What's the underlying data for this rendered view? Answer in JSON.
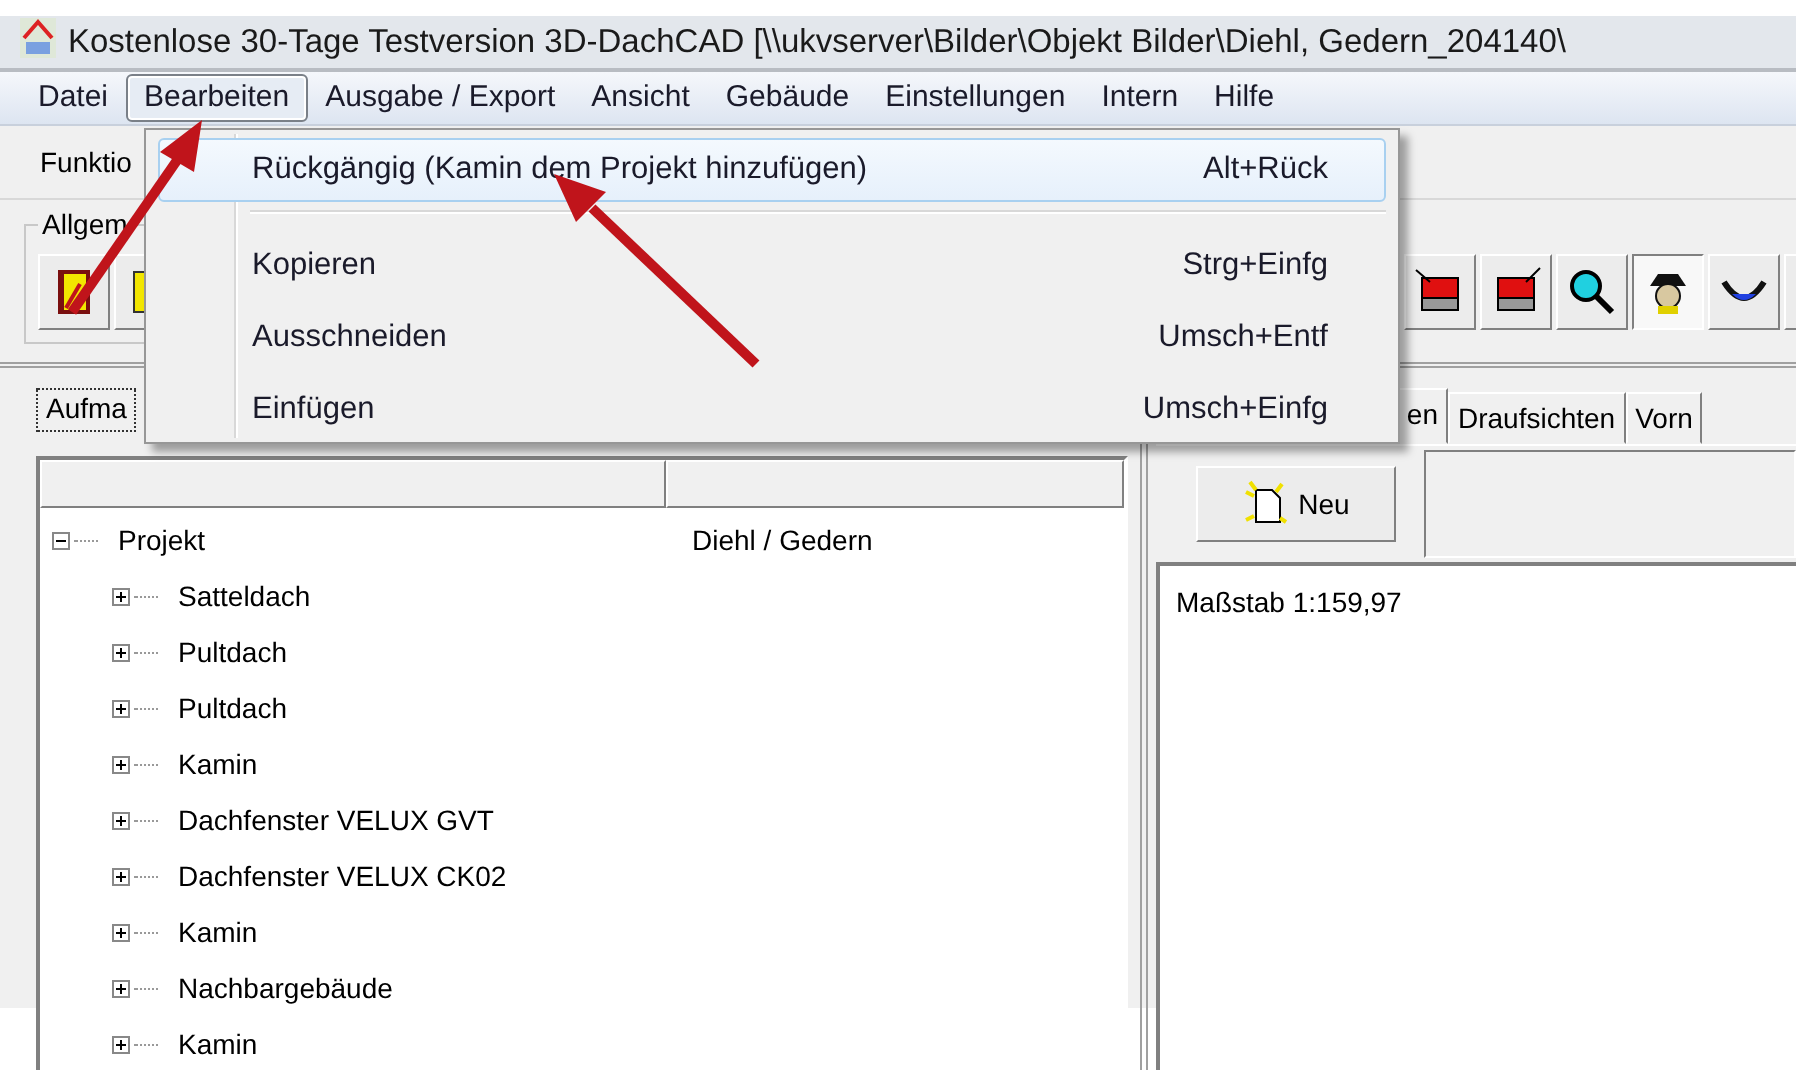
{
  "window": {
    "title": "Kostenlose 30-Tage Testversion 3D-DachCAD [\\\\ukvserver\\Bilder\\Objekt Bilder\\Diehl, Gedern_204140\\"
  },
  "menu_bar": [
    {
      "label": "Datei",
      "selected": false
    },
    {
      "label": "Bearbeiten",
      "selected": true
    },
    {
      "label": "Ausgabe / Export",
      "selected": false
    },
    {
      "label": "Ansicht",
      "selected": false
    },
    {
      "label": "Gebäude",
      "selected": false
    },
    {
      "label": "Einstellungen",
      "selected": false
    },
    {
      "label": "Intern",
      "selected": false
    },
    {
      "label": "Hilfe",
      "selected": false
    }
  ],
  "edit_menu": [
    {
      "kind": "command",
      "label": "Rückgängig (Kamin dem Projekt hinzufügen)",
      "shortcut": "Alt+Rück",
      "selected": true
    },
    {
      "kind": "separator"
    },
    {
      "kind": "command",
      "label": "Kopieren",
      "shortcut": "Strg+Einfg",
      "selected": false
    },
    {
      "kind": "command",
      "label": "Ausschneiden",
      "shortcut": "Umsch+Entf",
      "selected": false
    },
    {
      "kind": "command",
      "label": "Einfügen",
      "shortcut": "Umsch+Einfg",
      "selected": false
    }
  ],
  "function_panel": {
    "label": "Funktio",
    "group_label": "Allgem"
  },
  "left_tabs": [
    {
      "label": "Aufma",
      "selected": true
    }
  ],
  "tree": [
    {
      "label": "Projekt",
      "value": "Diehl / Gedern",
      "expanded": true,
      "children": [
        {
          "label": "Satteldach",
          "expanded": false
        },
        {
          "label": "Pultdach",
          "expanded": false
        },
        {
          "label": "Pultdach",
          "expanded": false
        },
        {
          "label": "Kamin",
          "expanded": false
        },
        {
          "label": "Dachfenster VELUX GVT",
          "expanded": false
        },
        {
          "label": "Dachfenster VELUX CK02",
          "expanded": false
        },
        {
          "label": "Kamin",
          "expanded": false
        },
        {
          "label": "Nachbargebäude",
          "expanded": false
        },
        {
          "label": "Kamin",
          "expanded": false
        }
      ]
    }
  ],
  "right_tabs": [
    {
      "label": "en",
      "selected": true
    },
    {
      "label": "Draufsichten",
      "selected": false
    },
    {
      "label": "Vorn",
      "selected": false
    }
  ],
  "new_button": "Neu",
  "canvas": {
    "scale_text": "Maßstab 1:159,97"
  }
}
